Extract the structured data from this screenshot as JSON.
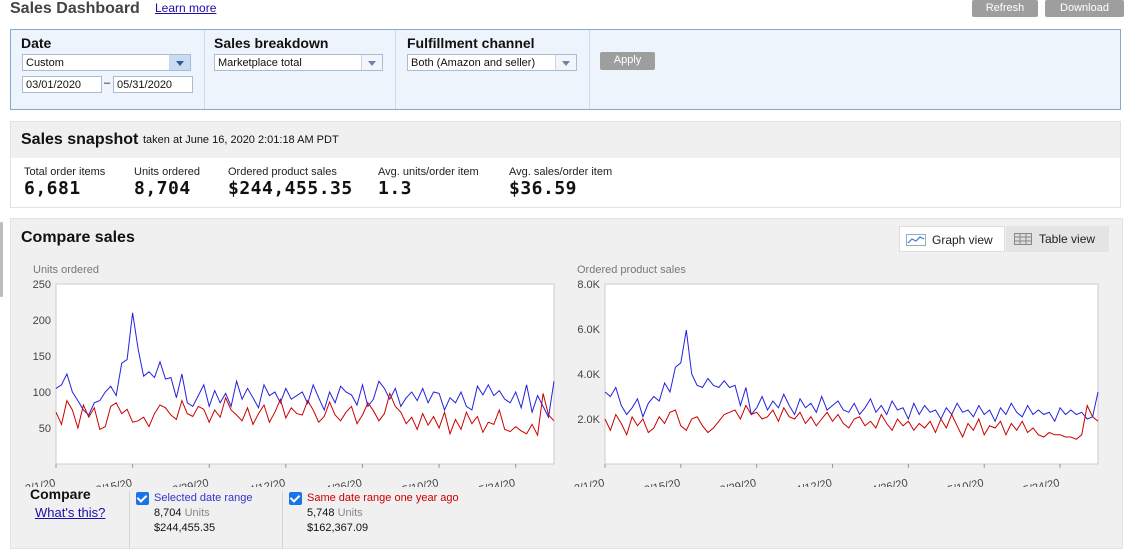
{
  "header": {
    "title": "Sales Dashboard",
    "learn_more": "Learn more",
    "refresh": "Refresh",
    "download": "Download"
  },
  "filters": {
    "date": {
      "label": "Date",
      "selected": "Custom",
      "from": "03/01/2020",
      "separator": "–",
      "to": "05/31/2020"
    },
    "breakdown": {
      "label": "Sales breakdown",
      "selected": "Marketplace total"
    },
    "fulfillment": {
      "label": "Fulfillment channel",
      "selected": "Both (Amazon and seller)"
    },
    "apply": "Apply"
  },
  "snapshot": {
    "title": "Sales snapshot",
    "taken": "taken at June 16, 2020 2:01:18 AM PDT",
    "metrics": [
      {
        "label": "Total order items",
        "value": "6,681"
      },
      {
        "label": "Units ordered",
        "value": "8,704"
      },
      {
        "label": "Ordered product sales",
        "value": "$244,455.35"
      },
      {
        "label": "Avg. units/order item",
        "value": "1.3"
      },
      {
        "label": "Avg. sales/order item",
        "value": "$36.59"
      }
    ]
  },
  "compare": {
    "title": "Compare sales",
    "graph_view": "Graph view",
    "table_view": "Table view",
    "compare_label": "Compare",
    "whats_this": "What's this?",
    "selected": {
      "label": "Selected date range",
      "units": "8,704",
      "units_suffix": "Units",
      "sales": "$244,455.35",
      "color": "#3333cc"
    },
    "previous": {
      "label": "Same date range one year ago",
      "units": "5,748",
      "units_suffix": "Units",
      "sales": "$162,367.09",
      "color": "#cc0000"
    }
  },
  "chart_data": [
    {
      "type": "line",
      "title": "Units ordered",
      "ylim": [
        0,
        250
      ],
      "yticks": [
        50,
        100,
        150,
        200,
        250
      ],
      "xticks": [
        "3/1/20",
        "3/15/20",
        "3/29/20",
        "4/12/20",
        "4/26/20",
        "5/10/20",
        "5/24/20"
      ],
      "x_days": 92,
      "series": [
        {
          "name": "Selected date range",
          "color": "#2222dd",
          "values": [
            105,
            110,
            125,
            100,
            88,
            75,
            68,
            85,
            88,
            100,
            108,
            95,
            140,
            145,
            210,
            160,
            122,
            128,
            120,
            142,
            118,
            120,
            92,
            125,
            85,
            80,
            95,
            110,
            80,
            102,
            85,
            98,
            80,
            115,
            90,
            105,
            92,
            78,
            110,
            95,
            100,
            85,
            105,
            90,
            95,
            100,
            84,
            110,
            92,
            75,
            100,
            85,
            108,
            100,
            96,
            82,
            110,
            80,
            90,
            115,
            105,
            90,
            105,
            80,
            92,
            100,
            88,
            105,
            85,
            100,
            98,
            75,
            92,
            85,
            100,
            80,
            75,
            108,
            96,
            110,
            95,
            102,
            90,
            85,
            100,
            78,
            110,
            72,
            95,
            80,
            65,
            115
          ]
        },
        {
          "name": "Same date range one year ago",
          "color": "#cc0000",
          "values": [
            72,
            55,
            88,
            75,
            50,
            82,
            65,
            78,
            48,
            52,
            80,
            85,
            70,
            76,
            58,
            60,
            65,
            52,
            70,
            82,
            78,
            68,
            62,
            88,
            70,
            66,
            80,
            76,
            58,
            75,
            65,
            92,
            75,
            68,
            60,
            78,
            55,
            70,
            82,
            58,
            72,
            90,
            64,
            78,
            70,
            68,
            88,
            75,
            58,
            66,
            86,
            68,
            60,
            72,
            80,
            56,
            68,
            85,
            74,
            60,
            70,
            98,
            80,
            72,
            56,
            65,
            48,
            70,
            54,
            66,
            50,
            72,
            42,
            62,
            48,
            72,
            56,
            66,
            44,
            58,
            55,
            75,
            48,
            45,
            52,
            46,
            42,
            55,
            40,
            98,
            68,
            60
          ]
        }
      ]
    },
    {
      "type": "line",
      "title": "Ordered product sales",
      "ylim": [
        0,
        8000
      ],
      "yticks": [
        2000,
        4000,
        6000,
        8000
      ],
      "yticklabels": [
        "2.0K",
        "4.0K",
        "6.0K",
        "8.0K"
      ],
      "xticks": [
        "3/1/20",
        "3/15/20",
        "3/29/20",
        "4/12/20",
        "4/26/20",
        "5/10/20",
        "5/24/20"
      ],
      "x_days": 92,
      "series": [
        {
          "name": "Selected date range",
          "color": "#2222dd",
          "values": [
            3200,
            3000,
            3400,
            2600,
            2200,
            2500,
            2900,
            2100,
            2700,
            3000,
            2800,
            3600,
            3200,
            4300,
            4500,
            5950,
            4000,
            3500,
            3400,
            3800,
            3500,
            3400,
            3700,
            3400,
            3500,
            2600,
            3400,
            2200,
            2500,
            3000,
            2400,
            2800,
            2500,
            3100,
            2600,
            2200,
            2900,
            2500,
            2700,
            2300,
            3000,
            2400,
            2600,
            2800,
            2400,
            2300,
            2700,
            2200,
            2500,
            2900,
            2300,
            2600,
            2200,
            2800,
            2400,
            2500,
            2000,
            2700,
            2200,
            2600,
            2300,
            2400,
            2000,
            2500,
            2200,
            2700,
            2300,
            2400,
            2100,
            2600,
            2200,
            2400,
            1900,
            2500,
            2200,
            2700,
            2300,
            2100,
            2600,
            2200,
            2400,
            2200,
            2300,
            1900,
            2500,
            2200,
            2400,
            2200,
            2300,
            2000,
            2100,
            3200
          ]
        },
        {
          "name": "Same date range one year ago",
          "color": "#cc0000",
          "values": [
            2000,
            1500,
            2200,
            1800,
            1300,
            2100,
            1700,
            2000,
            1400,
            1600,
            2100,
            1800,
            2300,
            2400,
            1700,
            1500,
            2000,
            2100,
            1700,
            1400,
            1600,
            1900,
            2200,
            2300,
            2400,
            2000,
            2600,
            2200,
            2300,
            2000,
            2100,
            2400,
            1900,
            2500,
            2100,
            2000,
            2300,
            1800,
            2100,
            1700,
            2000,
            2300,
            1900,
            2200,
            1800,
            1600,
            2000,
            2100,
            1700,
            1900,
            1600,
            2200,
            1800,
            1500,
            2000,
            1700,
            1900,
            1500,
            1800,
            1600,
            1900,
            1400,
            2000,
            1600,
            2200,
            1700,
            1200,
            1800,
            1500,
            2000,
            1300,
            1700,
            1600,
            1900,
            1300,
            1800,
            1500,
            1900,
            1400,
            1600,
            1300,
            1200,
            1400,
            1300,
            1300,
            1200,
            1200,
            1100,
            1300,
            2600,
            2100,
            1900
          ]
        }
      ]
    }
  ]
}
